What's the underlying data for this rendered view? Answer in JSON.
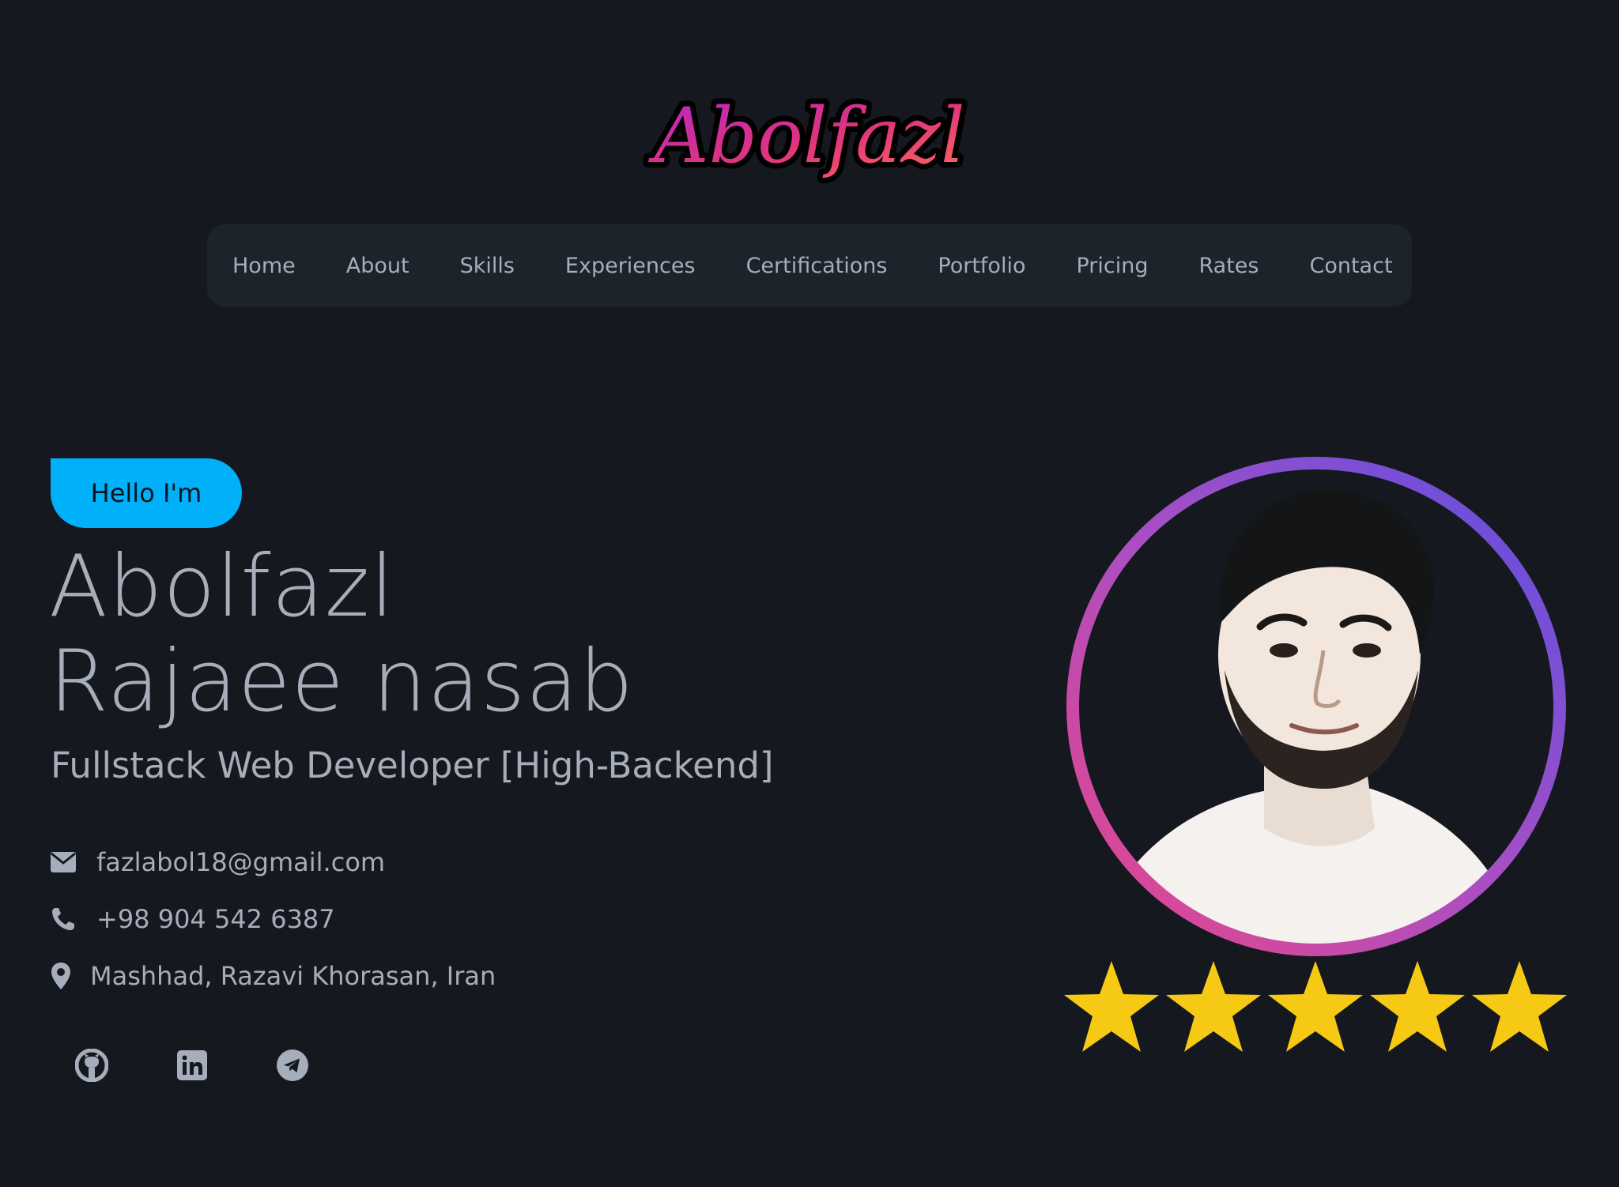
{
  "logo": {
    "text": "Abolfazl"
  },
  "nav": {
    "items": [
      "Home",
      "About",
      "Skills",
      "Experiences",
      "Certifications",
      "Portfolio",
      "Pricing",
      "Rates",
      "Contact"
    ]
  },
  "hero": {
    "greeting": "Hello I'm",
    "name_line1": "Abolfazl",
    "name_line2": "Rajaee nasab",
    "role": "Fullstack Web Developer [High-Backend]"
  },
  "contact": {
    "email": "fazlabol18@gmail.com",
    "phone": "+98 904 542 6387",
    "location": "Mashhad, Razavi Khorasan, Iran"
  },
  "socials": [
    {
      "icon": "github-icon"
    },
    {
      "icon": "linkedin-icon"
    },
    {
      "icon": "telegram-icon"
    }
  ],
  "rating": {
    "stars": 5,
    "max": 5
  },
  "colors": {
    "background": "#15181e",
    "nav_background": "#1d232a",
    "text": "#a6adbb",
    "accent_blue": "#00b0f8",
    "star": "#f6c915",
    "ring_start": "#e8468a",
    "ring_end": "#5b4fe0"
  }
}
